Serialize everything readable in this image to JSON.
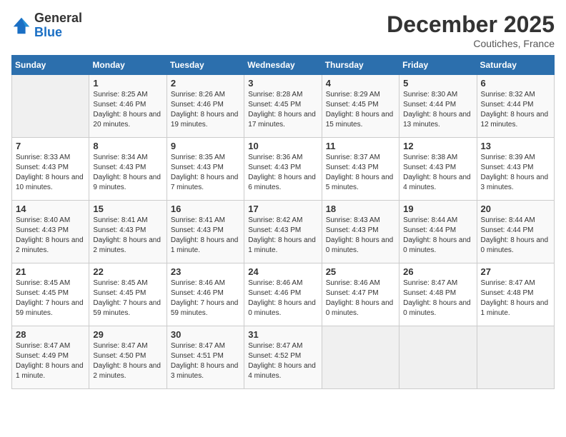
{
  "header": {
    "logo_general": "General",
    "logo_blue": "Blue",
    "month_title": "December 2025",
    "location": "Coutiches, France"
  },
  "days_of_week": [
    "Sunday",
    "Monday",
    "Tuesday",
    "Wednesday",
    "Thursday",
    "Friday",
    "Saturday"
  ],
  "weeks": [
    [
      {
        "day": "",
        "info": ""
      },
      {
        "day": "1",
        "info": "Sunrise: 8:25 AM\nSunset: 4:46 PM\nDaylight: 8 hours and 20 minutes."
      },
      {
        "day": "2",
        "info": "Sunrise: 8:26 AM\nSunset: 4:46 PM\nDaylight: 8 hours and 19 minutes."
      },
      {
        "day": "3",
        "info": "Sunrise: 8:28 AM\nSunset: 4:45 PM\nDaylight: 8 hours and 17 minutes."
      },
      {
        "day": "4",
        "info": "Sunrise: 8:29 AM\nSunset: 4:45 PM\nDaylight: 8 hours and 15 minutes."
      },
      {
        "day": "5",
        "info": "Sunrise: 8:30 AM\nSunset: 4:44 PM\nDaylight: 8 hours and 13 minutes."
      },
      {
        "day": "6",
        "info": "Sunrise: 8:32 AM\nSunset: 4:44 PM\nDaylight: 8 hours and 12 minutes."
      }
    ],
    [
      {
        "day": "7",
        "info": "Sunrise: 8:33 AM\nSunset: 4:43 PM\nDaylight: 8 hours and 10 minutes."
      },
      {
        "day": "8",
        "info": "Sunrise: 8:34 AM\nSunset: 4:43 PM\nDaylight: 8 hours and 9 minutes."
      },
      {
        "day": "9",
        "info": "Sunrise: 8:35 AM\nSunset: 4:43 PM\nDaylight: 8 hours and 7 minutes."
      },
      {
        "day": "10",
        "info": "Sunrise: 8:36 AM\nSunset: 4:43 PM\nDaylight: 8 hours and 6 minutes."
      },
      {
        "day": "11",
        "info": "Sunrise: 8:37 AM\nSunset: 4:43 PM\nDaylight: 8 hours and 5 minutes."
      },
      {
        "day": "12",
        "info": "Sunrise: 8:38 AM\nSunset: 4:43 PM\nDaylight: 8 hours and 4 minutes."
      },
      {
        "day": "13",
        "info": "Sunrise: 8:39 AM\nSunset: 4:43 PM\nDaylight: 8 hours and 3 minutes."
      }
    ],
    [
      {
        "day": "14",
        "info": "Sunrise: 8:40 AM\nSunset: 4:43 PM\nDaylight: 8 hours and 2 minutes."
      },
      {
        "day": "15",
        "info": "Sunrise: 8:41 AM\nSunset: 4:43 PM\nDaylight: 8 hours and 2 minutes."
      },
      {
        "day": "16",
        "info": "Sunrise: 8:41 AM\nSunset: 4:43 PM\nDaylight: 8 hours and 1 minute."
      },
      {
        "day": "17",
        "info": "Sunrise: 8:42 AM\nSunset: 4:43 PM\nDaylight: 8 hours and 1 minute."
      },
      {
        "day": "18",
        "info": "Sunrise: 8:43 AM\nSunset: 4:43 PM\nDaylight: 8 hours and 0 minutes."
      },
      {
        "day": "19",
        "info": "Sunrise: 8:44 AM\nSunset: 4:44 PM\nDaylight: 8 hours and 0 minutes."
      },
      {
        "day": "20",
        "info": "Sunrise: 8:44 AM\nSunset: 4:44 PM\nDaylight: 8 hours and 0 minutes."
      }
    ],
    [
      {
        "day": "21",
        "info": "Sunrise: 8:45 AM\nSunset: 4:45 PM\nDaylight: 7 hours and 59 minutes."
      },
      {
        "day": "22",
        "info": "Sunrise: 8:45 AM\nSunset: 4:45 PM\nDaylight: 7 hours and 59 minutes."
      },
      {
        "day": "23",
        "info": "Sunrise: 8:46 AM\nSunset: 4:46 PM\nDaylight: 7 hours and 59 minutes."
      },
      {
        "day": "24",
        "info": "Sunrise: 8:46 AM\nSunset: 4:46 PM\nDaylight: 8 hours and 0 minutes."
      },
      {
        "day": "25",
        "info": "Sunrise: 8:46 AM\nSunset: 4:47 PM\nDaylight: 8 hours and 0 minutes."
      },
      {
        "day": "26",
        "info": "Sunrise: 8:47 AM\nSunset: 4:48 PM\nDaylight: 8 hours and 0 minutes."
      },
      {
        "day": "27",
        "info": "Sunrise: 8:47 AM\nSunset: 4:48 PM\nDaylight: 8 hours and 1 minute."
      }
    ],
    [
      {
        "day": "28",
        "info": "Sunrise: 8:47 AM\nSunset: 4:49 PM\nDaylight: 8 hours and 1 minute."
      },
      {
        "day": "29",
        "info": "Sunrise: 8:47 AM\nSunset: 4:50 PM\nDaylight: 8 hours and 2 minutes."
      },
      {
        "day": "30",
        "info": "Sunrise: 8:47 AM\nSunset: 4:51 PM\nDaylight: 8 hours and 3 minutes."
      },
      {
        "day": "31",
        "info": "Sunrise: 8:47 AM\nSunset: 4:52 PM\nDaylight: 8 hours and 4 minutes."
      },
      {
        "day": "",
        "info": ""
      },
      {
        "day": "",
        "info": ""
      },
      {
        "day": "",
        "info": ""
      }
    ]
  ]
}
